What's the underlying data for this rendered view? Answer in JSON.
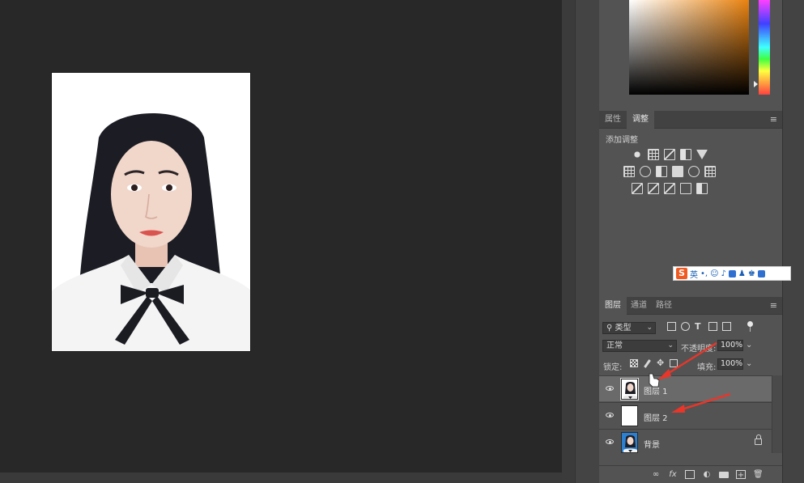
{
  "panels": {
    "adjustments": {
      "tabs": [
        {
          "label": "属性",
          "active": false
        },
        {
          "label": "调整",
          "active": true
        }
      ],
      "title": "添加调整"
    },
    "layers": {
      "tabs": [
        {
          "label": "图层",
          "active": true
        },
        {
          "label": "通道",
          "active": false
        },
        {
          "label": "路径",
          "active": false
        }
      ],
      "filter_kind": "类型",
      "blend_mode": "正常",
      "opacity_label": "不透明度:",
      "opacity_value": "100%",
      "lock_label": "锁定:",
      "fill_label": "填充:",
      "fill_value": "100%",
      "items": [
        {
          "name": "图层 1",
          "selected": true,
          "thumbnail": "portrait-photo"
        },
        {
          "name": "图层 2",
          "selected": false,
          "thumbnail": "white-fill"
        },
        {
          "name": "背景",
          "selected": false,
          "thumbnail": "portrait-blue",
          "locked": true
        }
      ]
    }
  },
  "ime_toolbar": {
    "logo": "S",
    "mode": "英"
  },
  "colors": {
    "app_bg": "#282828",
    "panel_bg": "#535353",
    "selected_layer": "#6a6a6a",
    "annotation": "#e8362a",
    "color_picker_hue": "#e8820f"
  },
  "icons": [
    "eye-icon",
    "lock-icon",
    "link-icon",
    "fx-icon",
    "mask-icon",
    "adjustment-layer-icon",
    "folder-icon",
    "new-layer-icon",
    "trash-icon"
  ]
}
